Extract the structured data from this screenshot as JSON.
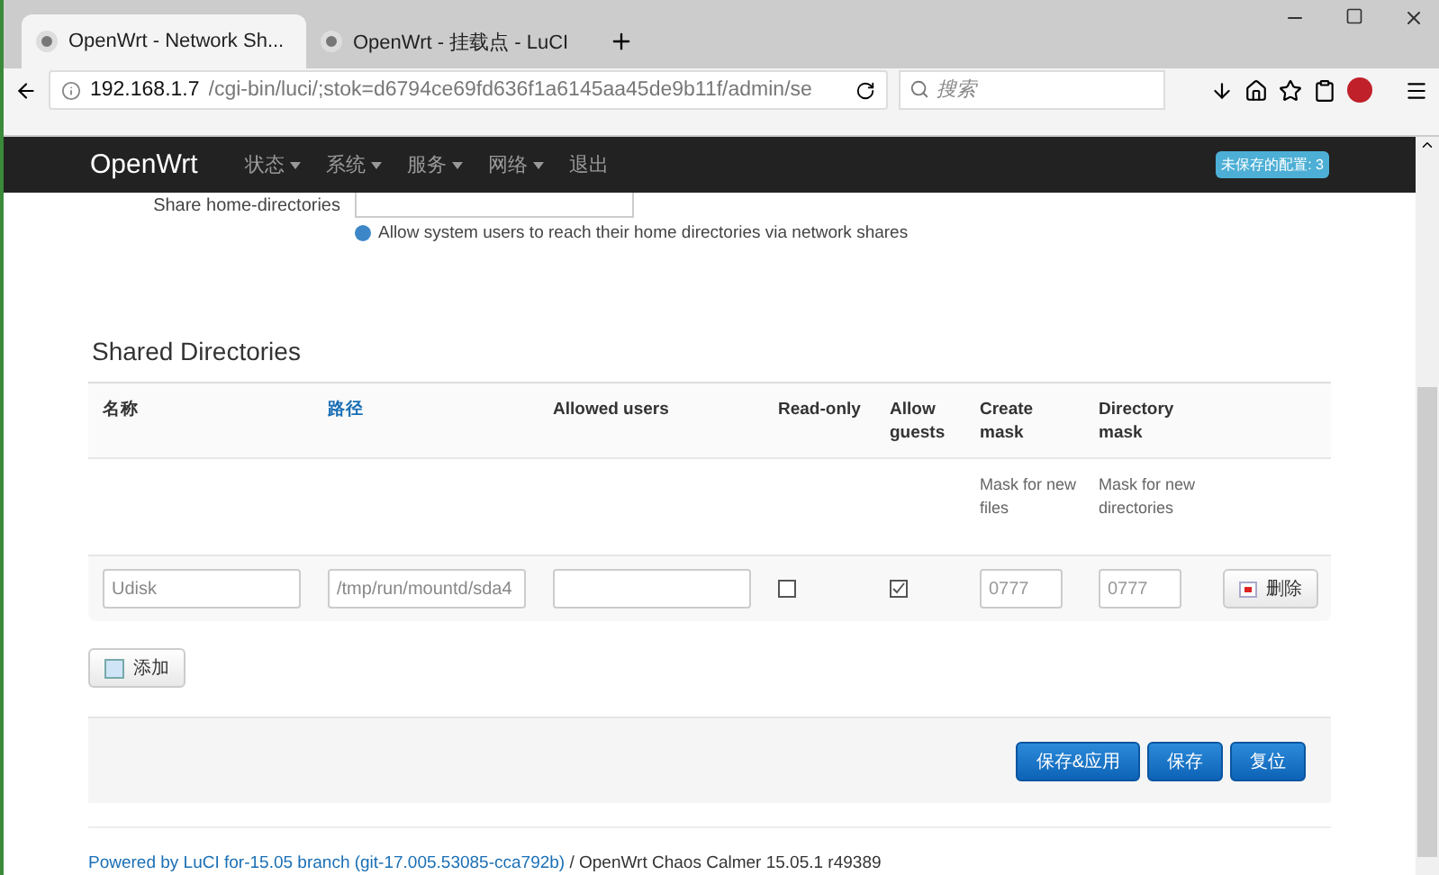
{
  "browser": {
    "tabs": [
      {
        "title": "OpenWrt - Network Sh...",
        "selected": true
      },
      {
        "title": "OpenWrt - 挂载点 - LuCI",
        "selected": false
      }
    ],
    "url": {
      "host": "192.168.1.7",
      "path": "/cgi-bin/luci/;stok=d6794ce69fd636f1a6145aa45de9b11f/admin/se"
    },
    "search": {
      "placeholder": "搜索"
    }
  },
  "navbar": {
    "brand": "OpenWrt",
    "menu": [
      {
        "label": "状态",
        "dropdown": true
      },
      {
        "label": "系统",
        "dropdown": true
      },
      {
        "label": "服务",
        "dropdown": true
      },
      {
        "label": "网络",
        "dropdown": true
      },
      {
        "label": "退出",
        "dropdown": false
      }
    ],
    "badge": "未保存的配置: 3"
  },
  "share_home": {
    "label": "Share home-directories",
    "help": "Allow system users to reach their home directories via network shares"
  },
  "section": {
    "title": "Shared Directories",
    "columns": [
      {
        "label": "名称",
        "link": false
      },
      {
        "label": "路径",
        "link": true
      },
      {
        "label": "Allowed users",
        "link": false
      },
      {
        "label": "Read-only",
        "link": false
      },
      {
        "label": "Allow guests",
        "link": false
      },
      {
        "label": "Create mask",
        "link": false,
        "help": "Mask for new files"
      },
      {
        "label": "Directory mask",
        "link": false,
        "help": "Mask for new directories"
      }
    ],
    "rows": [
      {
        "name": "Udisk",
        "path": "/tmp/run/mountd/sda4",
        "users": "",
        "read_only": false,
        "allow_guests": true,
        "create_mask_placeholder": "0777",
        "directory_mask_placeholder": "0777",
        "delete": "删除"
      }
    ],
    "add": "添加"
  },
  "actions": [
    {
      "label": "保存&应用"
    },
    {
      "label": "保存"
    },
    {
      "label": "复位"
    }
  ],
  "footer": {
    "link": "Powered by LuCI for-15.05 branch (git-17.005.53085-cca792b)",
    "text": " / OpenWrt Chaos Calmer 15.05.1 r49389"
  }
}
